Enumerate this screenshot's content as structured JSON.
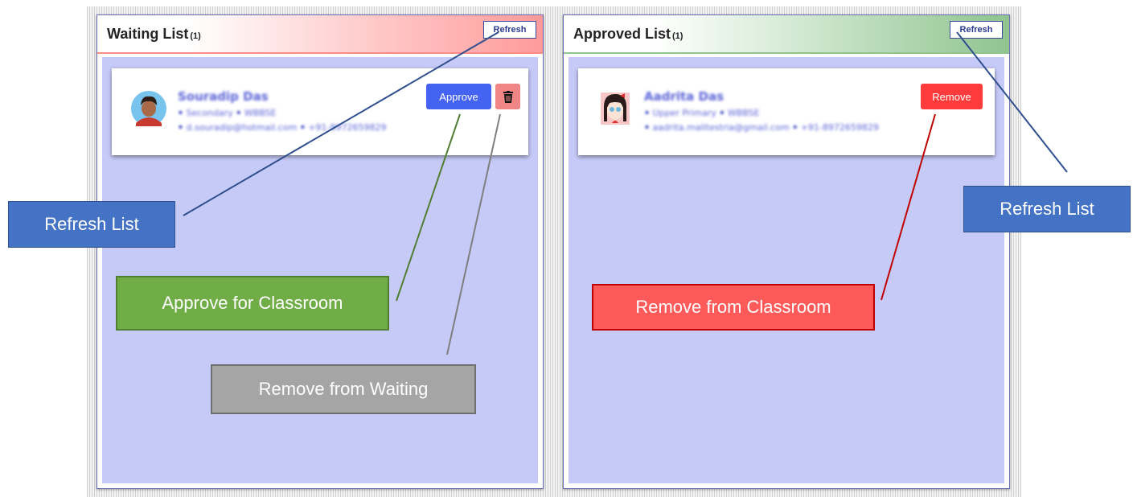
{
  "waiting": {
    "title": "Waiting List",
    "count": "(1)",
    "refresh_label": "Refresh",
    "student": {
      "name": "Souradip Das",
      "level": "Secondary",
      "board": "WBBSE",
      "email": "d.souradip@hotmail.com",
      "phone": "+91-8972659829"
    },
    "approve_label": "Approve",
    "delete_icon": "trash-icon"
  },
  "approved": {
    "title": "Approved List",
    "count": "(1)",
    "refresh_label": "Refresh",
    "student": {
      "name": "Aadrita Das",
      "level": "Upper Primary",
      "board": "WBBSE",
      "email": "aadrita.malitestria@gmail.com",
      "phone": "+91-8972659829"
    },
    "remove_label": "Remove"
  },
  "callouts": {
    "refresh_left": "Refresh List",
    "refresh_right": "Refresh List",
    "approve": "Approve for Classroom",
    "remove_waiting": "Remove from Waiting",
    "remove_classroom": "Remove from Classroom"
  },
  "colors": {
    "approve_button": "#4563f2",
    "remove_button": "#ff3b3b",
    "delete_button": "#f08585",
    "panel_body": "#c6caf7",
    "callout_blue": "#4472c4",
    "callout_green": "#70ad47",
    "callout_gray": "#a5a5a5",
    "callout_red": "#ff5a5a"
  }
}
